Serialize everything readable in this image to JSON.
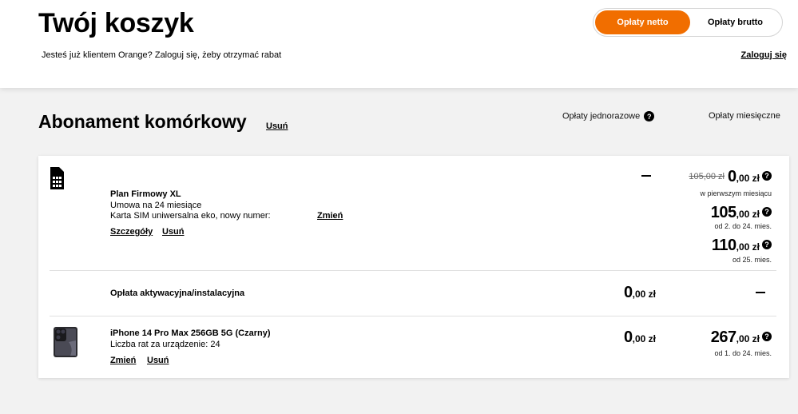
{
  "header": {
    "title": "Twój koszyk",
    "login_prompt": "Jesteś już klientem Orange? Zaloguj się, żeby otrzymać rabat",
    "login_link": "Zaloguj się",
    "toggle": {
      "net": "Opłaty netto",
      "gross": "Opłaty brutto",
      "selected": "net"
    }
  },
  "section": {
    "title": "Abonament komórkowy",
    "remove": "Usuń",
    "col_one_time": "Opłaty jednorazowe",
    "col_monthly": "Opłaty miesięczne"
  },
  "plan": {
    "icon": "sim-card-icon",
    "name": "Plan Firmowy XL",
    "contract": "Umowa na 24 miesiące",
    "sim": "Karta SIM uniwersalna eko, nowy numer:",
    "change": "Zmień",
    "details": "Szczegóły",
    "remove": "Usuń",
    "monthly": [
      {
        "old": "105,00 zł",
        "int": "0",
        "dec": ",00 zł",
        "note": "w pierwszym miesiącu"
      },
      {
        "int": "105",
        "dec": ",00 zł",
        "note": "od 2. do 24. mies."
      },
      {
        "int": "110",
        "dec": ",00 zł",
        "note": "od 25. mies."
      }
    ]
  },
  "activation": {
    "label": "Opłata aktywacyjna/instalacyjna",
    "one_time": {
      "int": "0",
      "dec": ",00 zł"
    }
  },
  "device": {
    "icon": "phone-image",
    "name": "iPhone 14 Pro Max 256GB 5G (Czarny)",
    "installments": "Liczba rat za urządzenie: 24",
    "change": "Zmień",
    "remove": "Usuń",
    "one_time": {
      "int": "0",
      "dec": ",00 zł"
    },
    "monthly": {
      "int": "267",
      "dec": ",00 zł",
      "note": "od 1. do 24. mies."
    }
  },
  "colors": {
    "accent": "#f16e00",
    "background": "#f2f2f2"
  }
}
